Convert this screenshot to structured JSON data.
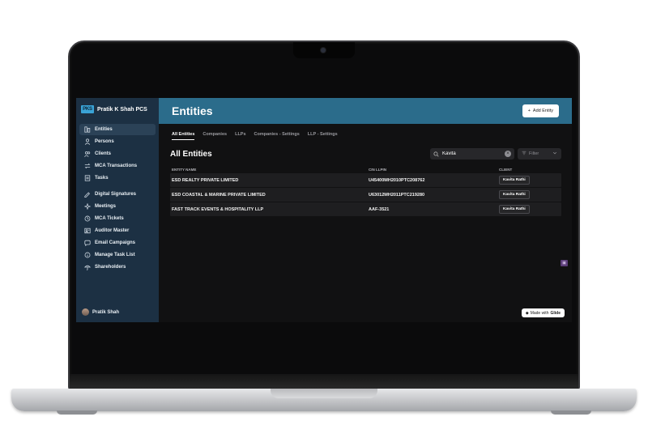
{
  "sidebar": {
    "brand_logo": "PKS",
    "brand_name": "Pratik K Shah PCS",
    "items": [
      {
        "label": "Entities",
        "icon": "entities-icon",
        "active": true
      },
      {
        "label": "Persons",
        "icon": "person-icon"
      },
      {
        "label": "Clients",
        "icon": "clients-icon"
      },
      {
        "label": "MCA Transactions",
        "icon": "exchange-icon"
      },
      {
        "label": "Tasks",
        "icon": "tasks-icon"
      },
      {
        "label": "Digital Signatures",
        "icon": "signature-icon"
      },
      {
        "label": "Meetings",
        "icon": "meetings-icon"
      },
      {
        "label": "MCA Tickets",
        "icon": "ticket-icon"
      },
      {
        "label": "Auditor Master",
        "icon": "auditor-icon"
      },
      {
        "label": "Email Campaigns",
        "icon": "email-icon"
      },
      {
        "label": "Manage Task List",
        "icon": "info-icon"
      },
      {
        "label": "Shareholders",
        "icon": "shareholders-icon"
      }
    ],
    "user_name": "Pratik Shah"
  },
  "header": {
    "title": "Entities",
    "add_button": "Add Entity"
  },
  "tabs": [
    "All Entities",
    "Companies",
    "LLPs",
    "Companies - Settings",
    "LLP - Settings"
  ],
  "section_title": "All Entities",
  "search": {
    "value": "Kavita",
    "placeholder": "Search"
  },
  "filter_label": "Filter",
  "table": {
    "columns": [
      "ENTITY NAME",
      "CIN LLPIN",
      "CLIENT"
    ],
    "rows": [
      {
        "name": "ESD REALTY PRIVATE LIMITED",
        "cin": "U45400MH2010PTC208762",
        "client": "Kavita Rathi"
      },
      {
        "name": "ESD COASTAL & MARINE PRIVATE LIMITED",
        "cin": "U63012MH2011PTC219280",
        "client": "Kavita Rathi"
      },
      {
        "name": "FAST TRACK EVENTS & HOSPITALITY LLP",
        "cin": "AAF-3521",
        "client": "Kavita Rathi"
      }
    ]
  },
  "glide_badge": {
    "prefix": "Made with",
    "brand": "Glide"
  },
  "colors": {
    "header": "#2b6c8b",
    "sidebar": "#1c3043",
    "brand_logo": "#3aa3d6"
  }
}
